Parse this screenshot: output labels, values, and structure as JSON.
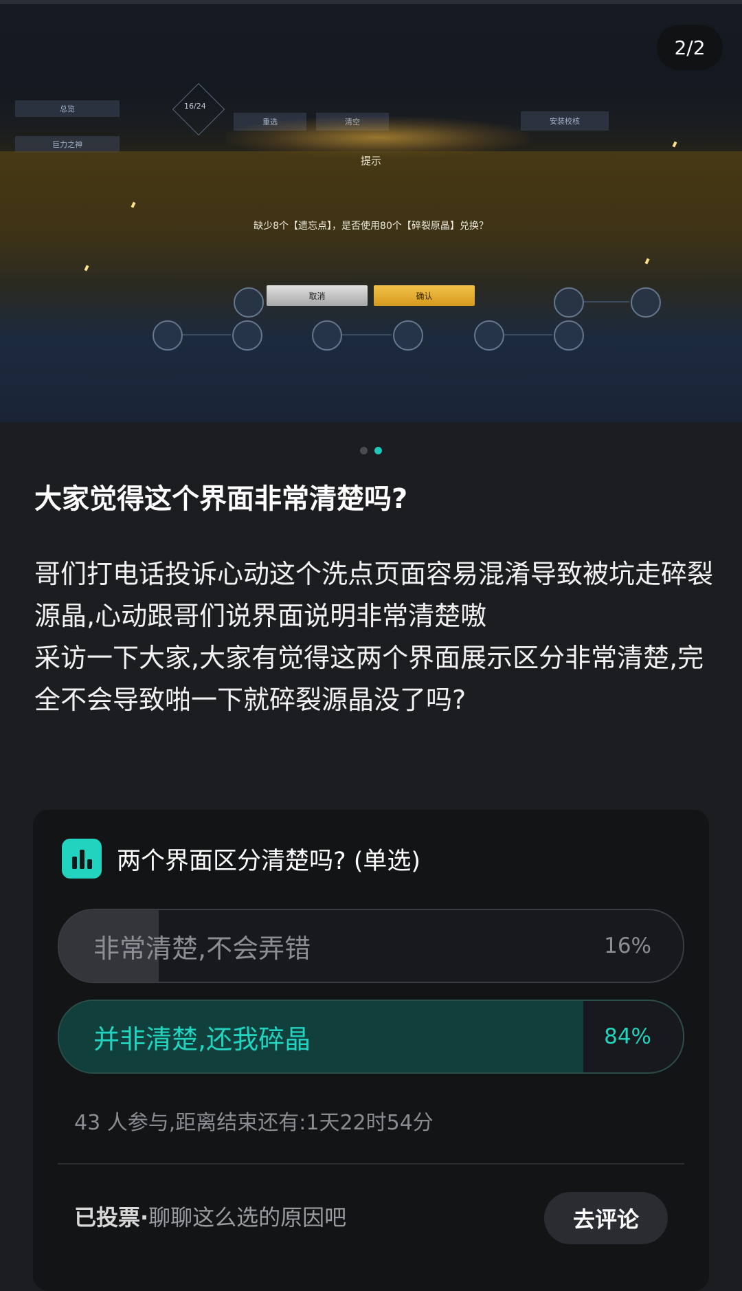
{
  "image": {
    "counter": "2/2",
    "dialog_title": "提示",
    "dialog_message": "缺少8个【遗忘点】，是否使用80个【碎裂原晶】兑换？",
    "cancel_label": "取消",
    "confirm_label": "确认",
    "tab_total": "总览",
    "tab_skill": "巨力之神",
    "btn_reset": "重选",
    "btn_clear": "清空",
    "btn_install": "安装校核",
    "counter_small": "16/24",
    "counter_small2": "24"
  },
  "carousel": {
    "total": 2,
    "active_index": 1
  },
  "post": {
    "title": "大家觉得这个界面非常清楚吗?",
    "paragraphs": [
      "哥们打电话投诉心动这个洗点页面容易混淆导致被坑走碎裂源晶,心动跟哥们说界面说明非常清楚嗷",
      "采访一下大家,大家有觉得这两个界面展示区分非常清楚,完全不会导致啪一下就碎裂源晶没了吗?"
    ]
  },
  "poll": {
    "title": "两个界面区分清楚吗? (单选)",
    "options": [
      {
        "label": "非常清楚,不会弄错",
        "percent": "16%",
        "share": 0.16,
        "selected": false
      },
      {
        "label": "并非清楚,还我碎晶",
        "percent": "84%",
        "share": 0.84,
        "selected": true
      }
    ],
    "meta": "43 人参与,距离结束还有:1天22时54分",
    "voted_label": "已投票·",
    "prompt": "聊聊这么选的原因吧",
    "comment_button": "去评论"
  },
  "colors": {
    "accent": "#22d3c0",
    "background": "#1c1d21",
    "card": "#131416",
    "selected_fill": "#103f3c",
    "unselected_fill": "#33353b"
  }
}
